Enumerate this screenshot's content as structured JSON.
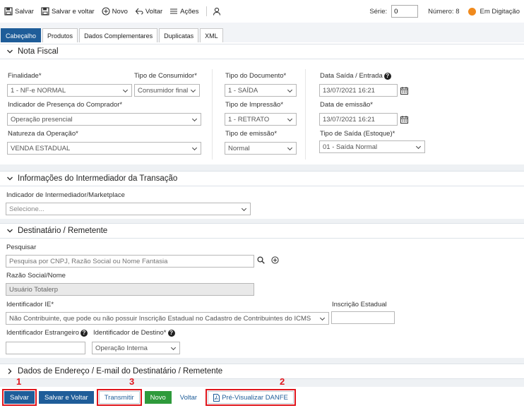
{
  "toolbar": {
    "salvar": "Salvar",
    "salvar_voltar": "Salvar e voltar",
    "novo": "Novo",
    "voltar": "Voltar",
    "acoes": "Ações",
    "serie_label": "Série:",
    "serie_value": "0",
    "numero_label": "Número: 8",
    "status": "Em Digitação",
    "status_color": "#f08a1d"
  },
  "tabs": [
    "Cabeçalho",
    "Produtos",
    "Dados Complementares",
    "Duplicatas",
    "XML"
  ],
  "nota_fiscal": {
    "title": "Nota Fiscal",
    "finalidade_label": "Finalidade*",
    "finalidade_value": "1 - NF-e NORMAL",
    "tipo_consumidor_label": "Tipo de Consumidor*",
    "tipo_consumidor_value": "Consumidor final",
    "indicador_presenca_label": "Indicador de Presença do Comprador*",
    "indicador_presenca_value": "Operação presencial",
    "natureza_label": "Natureza da Operação*",
    "natureza_value": "VENDA ESTADUAL",
    "tipo_documento_label": "Tipo do Documento*",
    "tipo_documento_value": "1 - SAÍDA",
    "tipo_impressao_label": "Tipo de Impressão*",
    "tipo_impressao_value": "1 - RETRATO",
    "tipo_emissao_label": "Tipo de emissão*",
    "tipo_emissao_value": "Normal",
    "data_saida_label": "Data Saída / Entrada",
    "data_saida_value": "13/07/2021 16:21",
    "data_emissao_label": "Data de emissão*",
    "data_emissao_value": "13/07/2021 16:21",
    "tipo_saida_label": "Tipo de Saída (Estoque)*",
    "tipo_saida_value": "01 - Saída Normal"
  },
  "intermediador": {
    "title": "Informações do Intermediador da Transação",
    "label": "Indicador de Intermediador/Marketplace",
    "placeholder": "Selecione..."
  },
  "destinatario": {
    "title": "Destinatário / Remetente",
    "pesquisar_label": "Pesquisar",
    "pesquisar_placeholder": "Pesquisa por CNPJ, Razão Social ou Nome Fantasia",
    "razao_label": "Razão Social/Nome",
    "razao_value": "Usuário Totalerp",
    "ident_ie_label": "Identificador IE*",
    "ident_ie_value": "Não Contribuinte, que pode ou não possuir Inscrição Estadual no Cadastro de Contribuintes do ICMS",
    "inscricao_label": "Inscrição Estadual",
    "inscricao_value": "",
    "ident_estrangeiro_label": "Identificador Estrangeiro",
    "ident_estrangeiro_value": "",
    "ident_destino_label": "Identificador de Destino*",
    "ident_destino_value": "Operação Interna"
  },
  "endereco": {
    "title": "Dados de Endereço / E-mail do Destinatário / Remetente"
  },
  "bottom": {
    "salvar": "Salvar",
    "salvar_voltar": "Salvar e Voltar",
    "transmitir": "Transmitir",
    "novo": "Novo",
    "voltar": "Voltar",
    "pre_visualizar": "Pré-Visualizar DANFE"
  },
  "annotations": {
    "n1": "1",
    "n2": "2",
    "n3": "3",
    "color": "#e0161d"
  }
}
